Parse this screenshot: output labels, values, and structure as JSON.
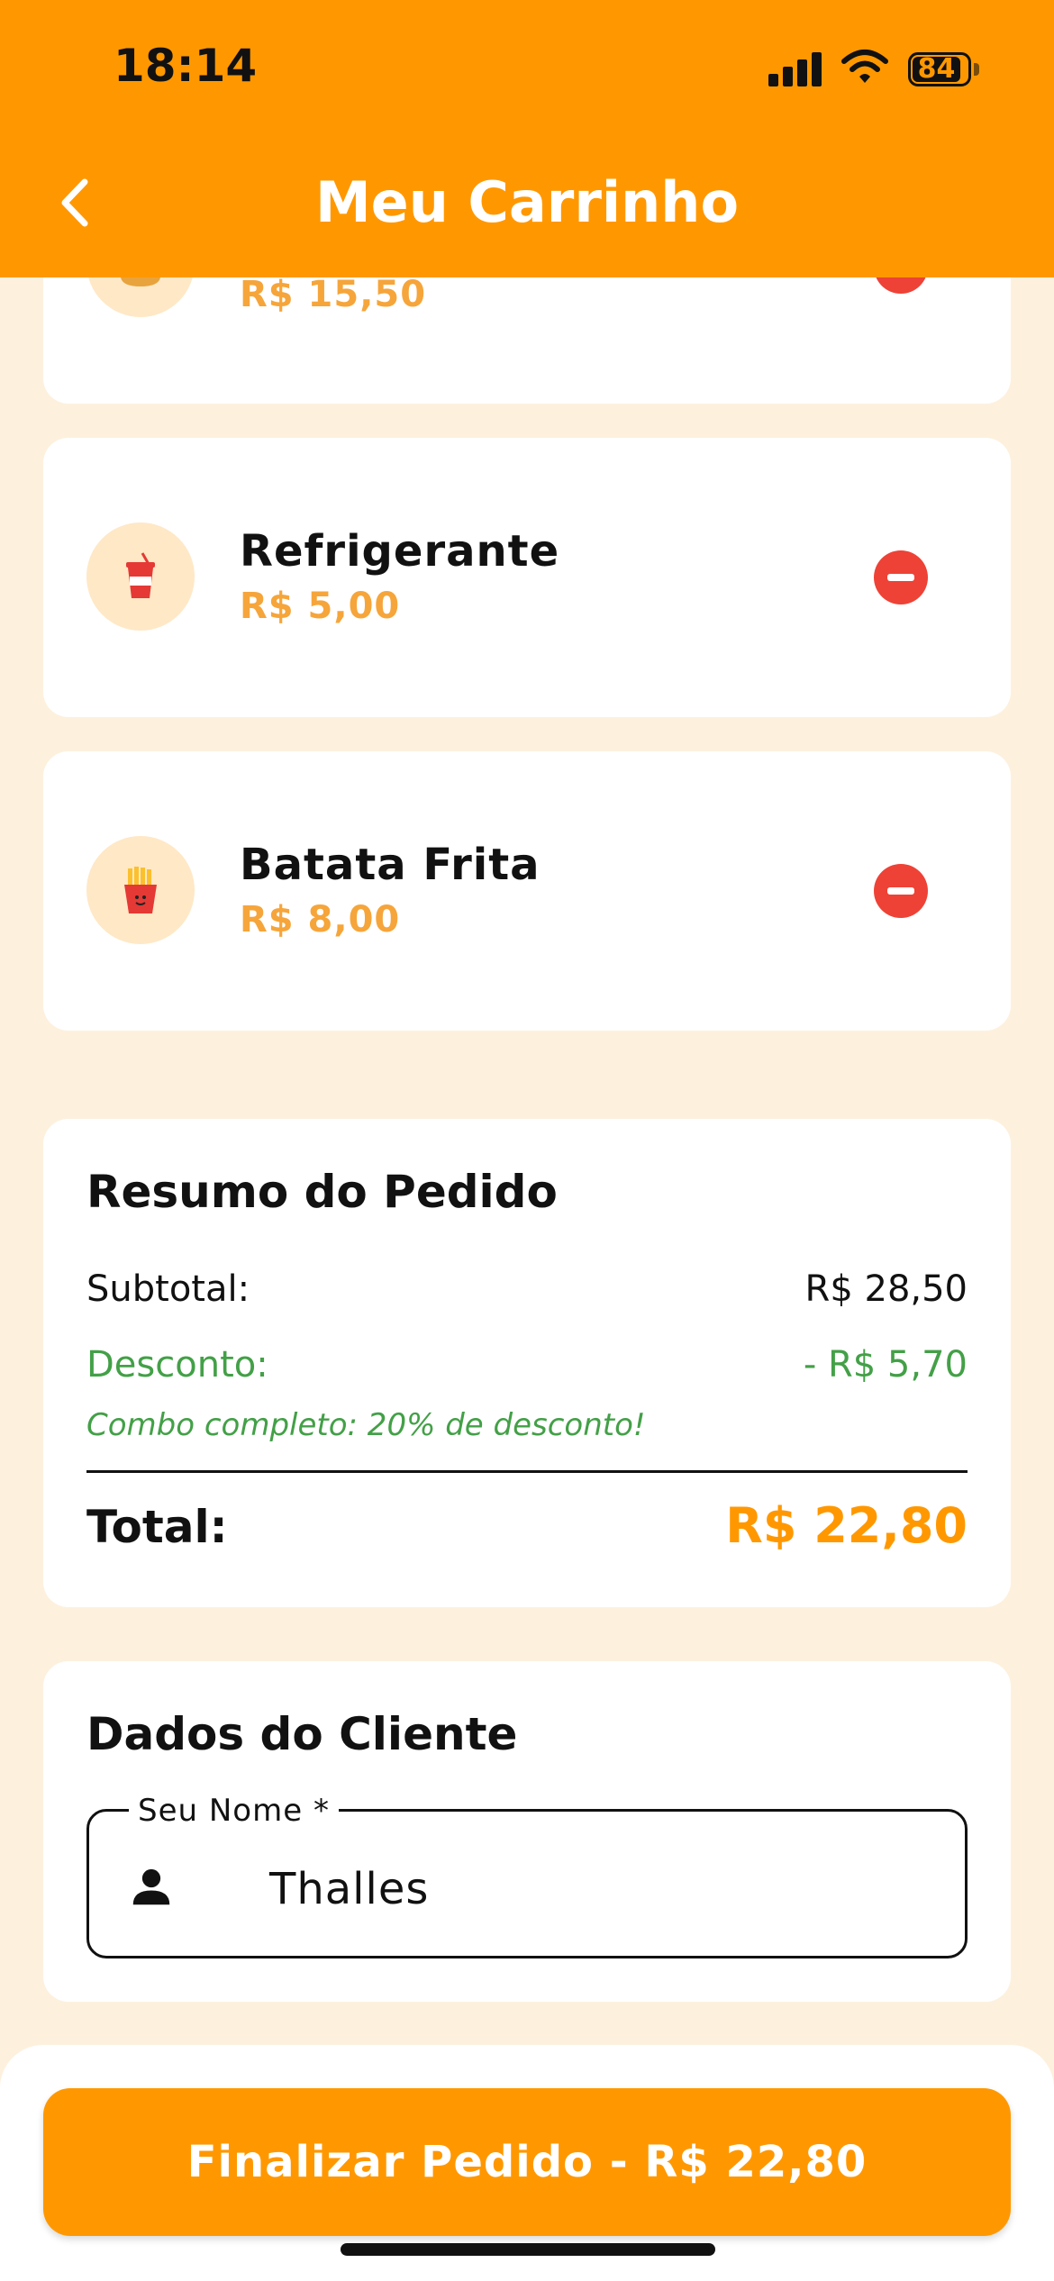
{
  "status_bar": {
    "time": "18:14",
    "battery": "84"
  },
  "header": {
    "title": "Meu Carrinho",
    "back_icon": "chevron-left-icon"
  },
  "colors": {
    "primary": "#FF9800",
    "price": "#F6A53A",
    "remove": "#EE4236",
    "discount": "#43A047",
    "background": "#FDF1DE"
  },
  "cart": {
    "items": [
      {
        "name": "",
        "price": "R$ 15,50",
        "icon": "burger-icon"
      },
      {
        "name": "Refrigerante",
        "price": "R$ 5,00",
        "icon": "soda-cup-icon"
      },
      {
        "name": "Batata Frita",
        "price": "R$ 8,00",
        "icon": "french-fries-icon"
      }
    ]
  },
  "summary": {
    "title": "Resumo do Pedido",
    "subtotal_label": "Subtotal:",
    "subtotal_value": "R$ 28,50",
    "discount_label": "Desconto:",
    "discount_value": "- R$ 5,70",
    "discount_note": "Combo completo: 20% de desconto!",
    "total_label": "Total:",
    "total_value": "R$ 22,80"
  },
  "customer": {
    "title": "Dados do Cliente",
    "name_label": "Seu Nome *",
    "name_value": "Thalles",
    "name_icon": "person-icon"
  },
  "checkout": {
    "button_label": "Finalizar Pedido - R$ 22,80"
  }
}
